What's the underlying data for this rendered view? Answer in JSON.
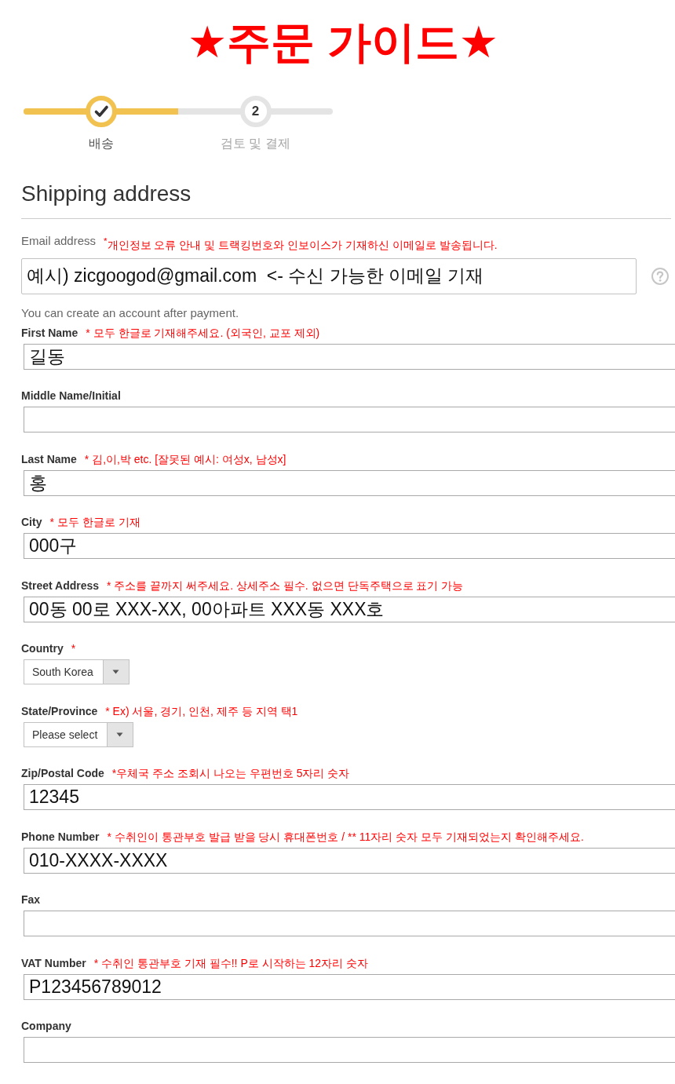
{
  "title": "★주문 가이드★",
  "steps": [
    {
      "label": "배송",
      "completed": true
    },
    {
      "number": "2",
      "label": "검토 및 결제",
      "completed": false
    }
  ],
  "section_title": "Shipping address",
  "email": {
    "label": "Email address",
    "note": "$^{*}$개인정보 오류 안내 및 트랙킹번호와 인보이스가 기재하신 이메일로 발송됩니다.",
    "value": "예시) zicgoogod@gmail.com  <- 수신 가능한 이메일 기재",
    "hint": "You can create an account after payment."
  },
  "fields": [
    {
      "kind": "input",
      "label": "First Name",
      "note": "* 모두 한글로 기재해주세요. (외국인, 교포 제외)",
      "value": "길동"
    },
    {
      "kind": "input",
      "label": "Middle Name/Initial"
    },
    {
      "kind": "input",
      "label": "Last Name",
      "note": "* 김,이,박 etc. [잘못된 예시: 여성x, 남성x]",
      "value": "홍"
    },
    {
      "kind": "input",
      "label": "City",
      "note": "* 모두 한글로 기재",
      "value": "000구"
    },
    {
      "kind": "input",
      "label": "Street Address",
      "note": "* 주소를 끝까지 써주세요. 상세주소 필수. 없으면 단독주택으로 표기 가능",
      "value": "00동 00로 XXX-XX, 00아파트 XXX동 XXX호"
    },
    {
      "kind": "select",
      "label": "Country",
      "note": "*",
      "value": "South Korea"
    },
    {
      "kind": "select",
      "label": "State/Province",
      "note": "* Ex) 서울, 경기, 인천, 제주 등 지역 택1",
      "value": "Please select"
    },
    {
      "kind": "input",
      "label": "Zip/Postal Code",
      "note": "*우체국 주소 조회시 나오는 우편번호 5자리 숫자",
      "value": "12345"
    },
    {
      "kind": "input",
      "label": "Phone Number",
      "note": "* 수취인이 통관부호 발급 받을 당시 휴대폰번호 / ** 11자리 숫자 모두 기재되었는지 확인해주세요.",
      "value": "010-XXXX-XXXX"
    },
    {
      "kind": "input",
      "label": "Fax"
    },
    {
      "kind": "input",
      "label": "VAT Number",
      "note": "* 수취인 통관부호 기재 필수!! P로 시작하는 12자리 숫자",
      "value": "P123456789012"
    },
    {
      "kind": "input",
      "label": "Company"
    }
  ]
}
